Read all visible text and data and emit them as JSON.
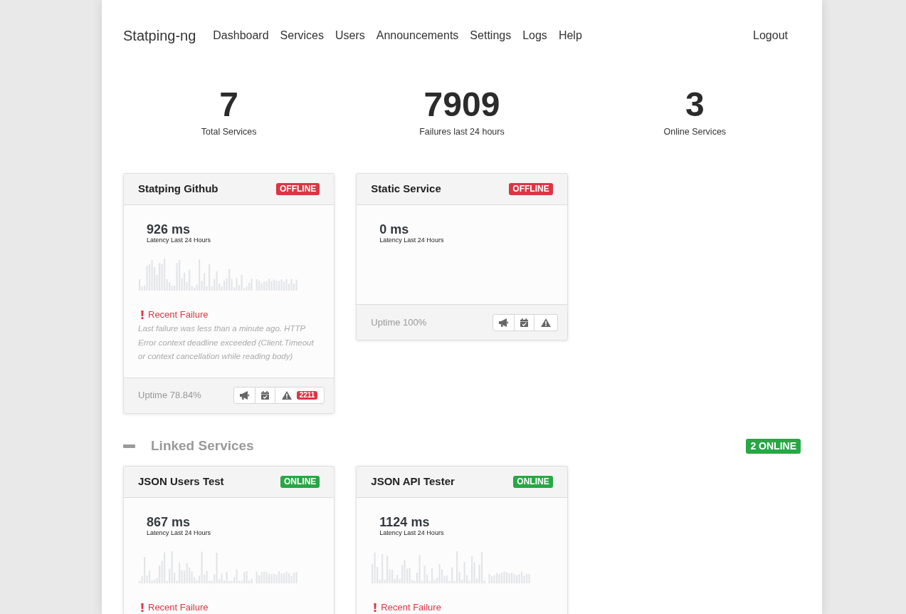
{
  "nav": {
    "brand": "Statping-ng",
    "links": [
      "Dashboard",
      "Services",
      "Users",
      "Announcements",
      "Settings",
      "Logs",
      "Help"
    ],
    "logout": "Logout"
  },
  "stats": [
    {
      "value": "7",
      "label": "Total Services"
    },
    {
      "value": "7909",
      "label": "Failures last 24 hours"
    },
    {
      "value": "3",
      "label": "Online Services"
    }
  ],
  "services": [
    {
      "name": "Statping Github",
      "status": "OFFLINE",
      "online": false,
      "latency": "926 ms",
      "latency_label": "Latency Last 24 Hours",
      "sparkline": true,
      "failure": {
        "title": "Recent Failure",
        "message": "Last failure was less than a minute ago. HTTP Error context deadline exceeded (Client.Timeout or context cancellation while reading body)"
      },
      "uptime": "Uptime 78.84%",
      "failure_count": "2211"
    },
    {
      "name": "Static Service",
      "status": "OFFLINE",
      "online": false,
      "latency": "0 ms",
      "latency_label": "Latency Last 24 Hours",
      "sparkline": false,
      "uptime": "Uptime 100%"
    }
  ],
  "groups": [
    {
      "title": "Linked Services",
      "expanded": true,
      "badge": "2 ONLINE",
      "services": [
        {
          "name": "JSON Users Test",
          "status": "ONLINE",
          "online": true,
          "latency": "867 ms",
          "latency_label": "Latency Last 24 Hours",
          "sparkline": true,
          "failure": {
            "title": "Recent Failure"
          }
        },
        {
          "name": "JSON API Tester",
          "status": "ONLINE",
          "online": true,
          "latency": "1124 ms",
          "latency_label": "Latency Last 24 Hours",
          "sparkline": true,
          "failure": {
            "title": "Recent Failure"
          }
        }
      ]
    }
  ]
}
